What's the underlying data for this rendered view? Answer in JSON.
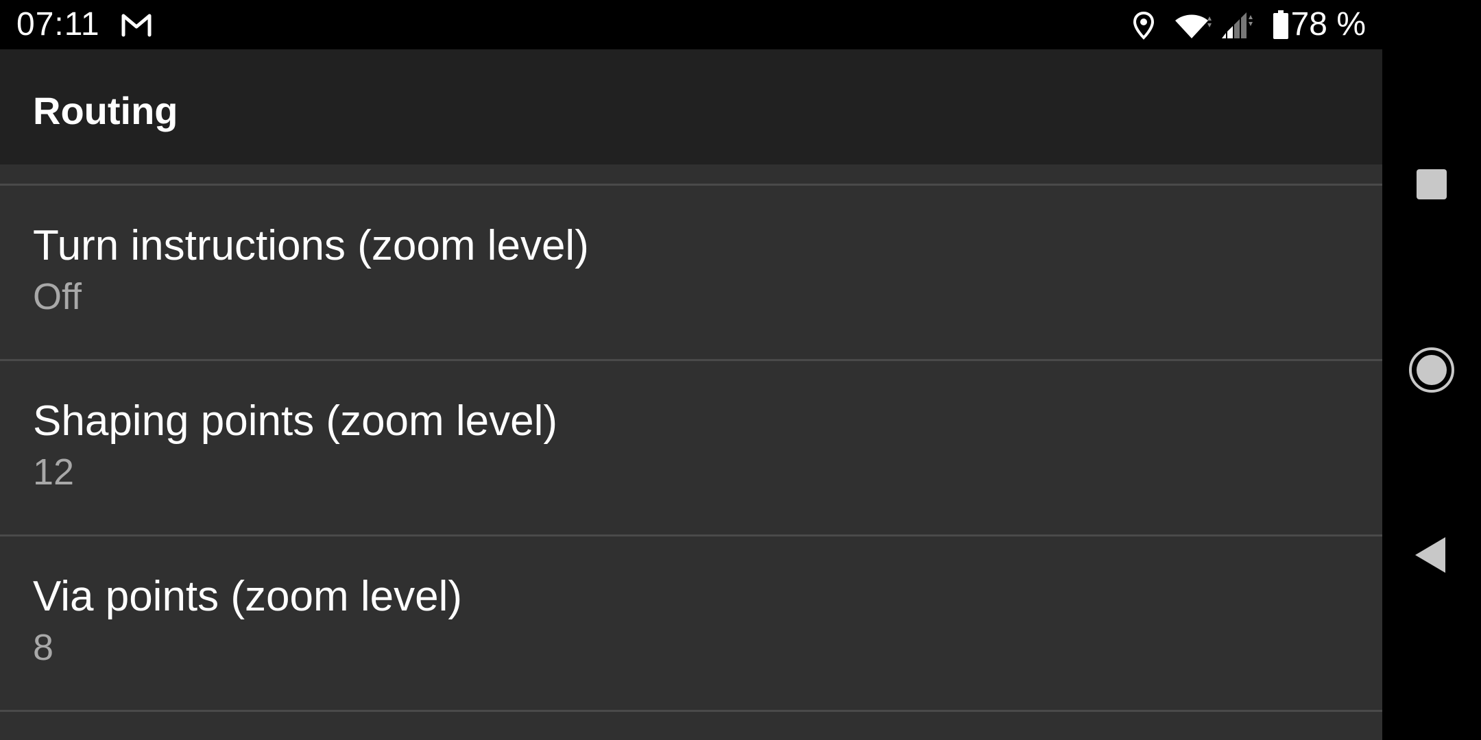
{
  "status_bar": {
    "time": "07:11",
    "notification_icon": "gmail-icon",
    "icons": [
      "location-icon",
      "wifi-icon",
      "cell-signal-icon",
      "battery-icon"
    ],
    "battery": "78 %"
  },
  "toolbar": {
    "title": "Routing"
  },
  "preferences": [
    {
      "title": "Turn instructions (zoom level)",
      "summary": "Off"
    },
    {
      "title": "Shaping points (zoom level)",
      "summary": "12"
    },
    {
      "title": "Via points (zoom level)",
      "summary": "8"
    }
  ],
  "navigation_bar": {
    "buttons": [
      "recents-button",
      "home-button",
      "back-button"
    ]
  },
  "colors": {
    "status_bar": "#000000",
    "toolbar": "#212121",
    "list_background": "#303030",
    "divider": "#4a4a4a",
    "title_text": "#ffffff",
    "summary_text": "#a8a8a8"
  }
}
